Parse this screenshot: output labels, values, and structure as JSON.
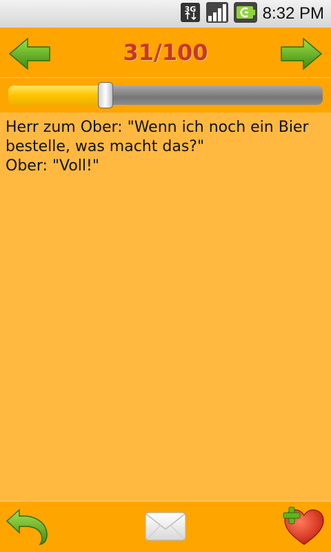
{
  "status_bar": {
    "time": "8:32 PM",
    "network_label": "3G",
    "icons": [
      "3g-icon",
      "signal-icon",
      "battery-icon"
    ]
  },
  "header": {
    "counter": "31/100",
    "prev_icon": "arrow-left-icon",
    "next_icon": "arrow-right-icon"
  },
  "slider": {
    "value": 31,
    "max": 100
  },
  "joke": {
    "text": "Herr zum Ober: \"Wenn ich noch ein Bier bestelle, was macht das?\"\nOber: \"Voll!\""
  },
  "bottom_bar": {
    "icons": [
      "back-icon",
      "mail-icon",
      "favorite-add-icon"
    ]
  },
  "colors": {
    "background": "#ffb940",
    "bars": "#ffa500",
    "counter": "#c8372a",
    "arrow_green": "#5aa81e"
  }
}
